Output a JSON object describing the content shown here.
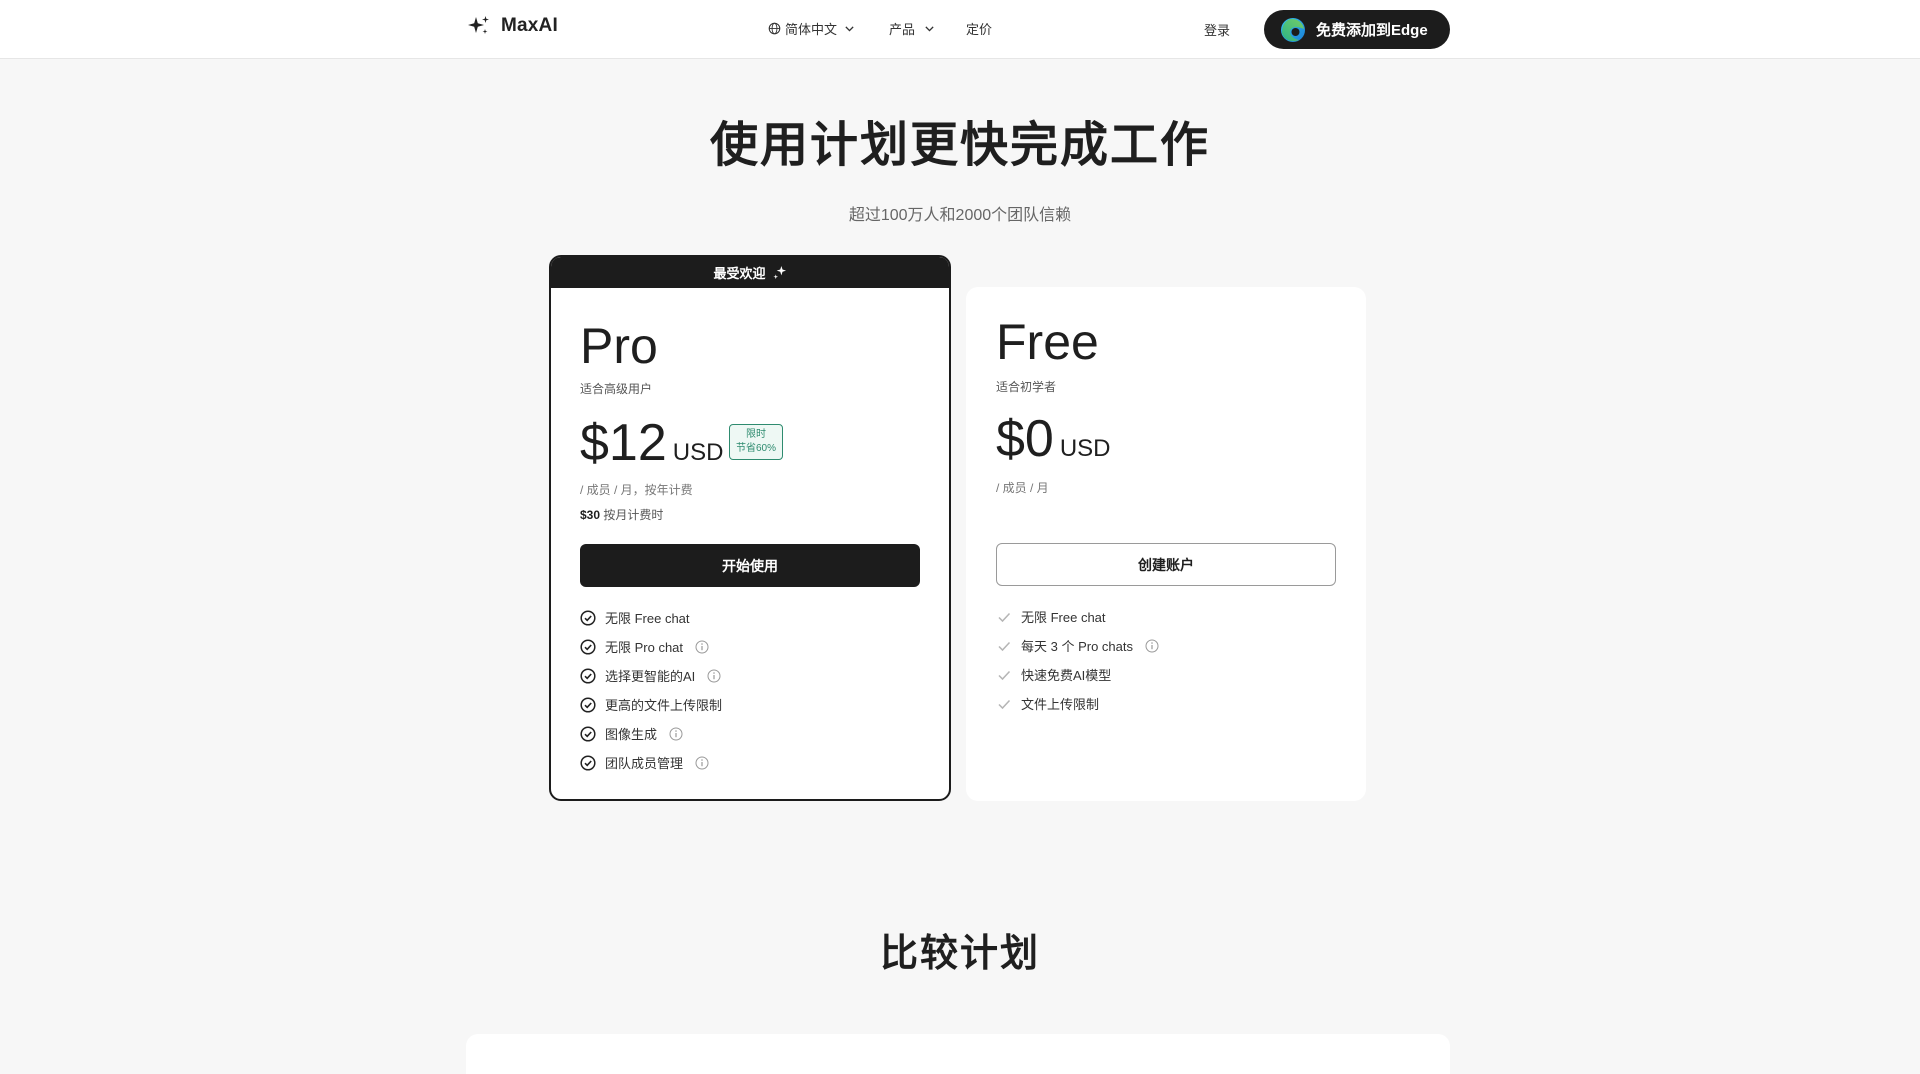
{
  "header": {
    "logo_text": "MaxAI",
    "nav": {
      "language": "简体中文",
      "products": "产品",
      "pricing": "定价"
    },
    "login": "登录",
    "cta": "免费添加到Edge"
  },
  "hero": {
    "title": "使用计划更快完成工作",
    "subtitle": "超过100万人和2000个团队信赖"
  },
  "plans": {
    "pro": {
      "banner": "最受欢迎",
      "name": "Pro",
      "desc": "适合高级用户",
      "price": "$12",
      "currency": "USD",
      "badge_line1": "限时",
      "badge_line2": "节省60%",
      "period": "/ 成员 / 月，按年计费",
      "monthly_price": "$30",
      "monthly_note": "按月计费时",
      "button": "开始使用",
      "features": [
        "无限 Free chat",
        "无限 Pro chat",
        "选择更智能的AI",
        "更高的文件上传限制",
        "图像生成",
        "团队成员管理"
      ]
    },
    "free": {
      "name": "Free",
      "desc": "适合初学者",
      "price": "$0",
      "currency": "USD",
      "period": "/ 成员 / 月",
      "button": "创建账户",
      "features": [
        "无限 Free chat",
        "每天 3 个 Pro chats",
        "快速免费AI模型",
        "文件上传限制"
      ]
    }
  },
  "compare": {
    "title": "比较计划"
  },
  "colors": {
    "dark": "#1c1c1c",
    "badge_green": "#2e8b6f",
    "background": "#f7f7f7"
  }
}
